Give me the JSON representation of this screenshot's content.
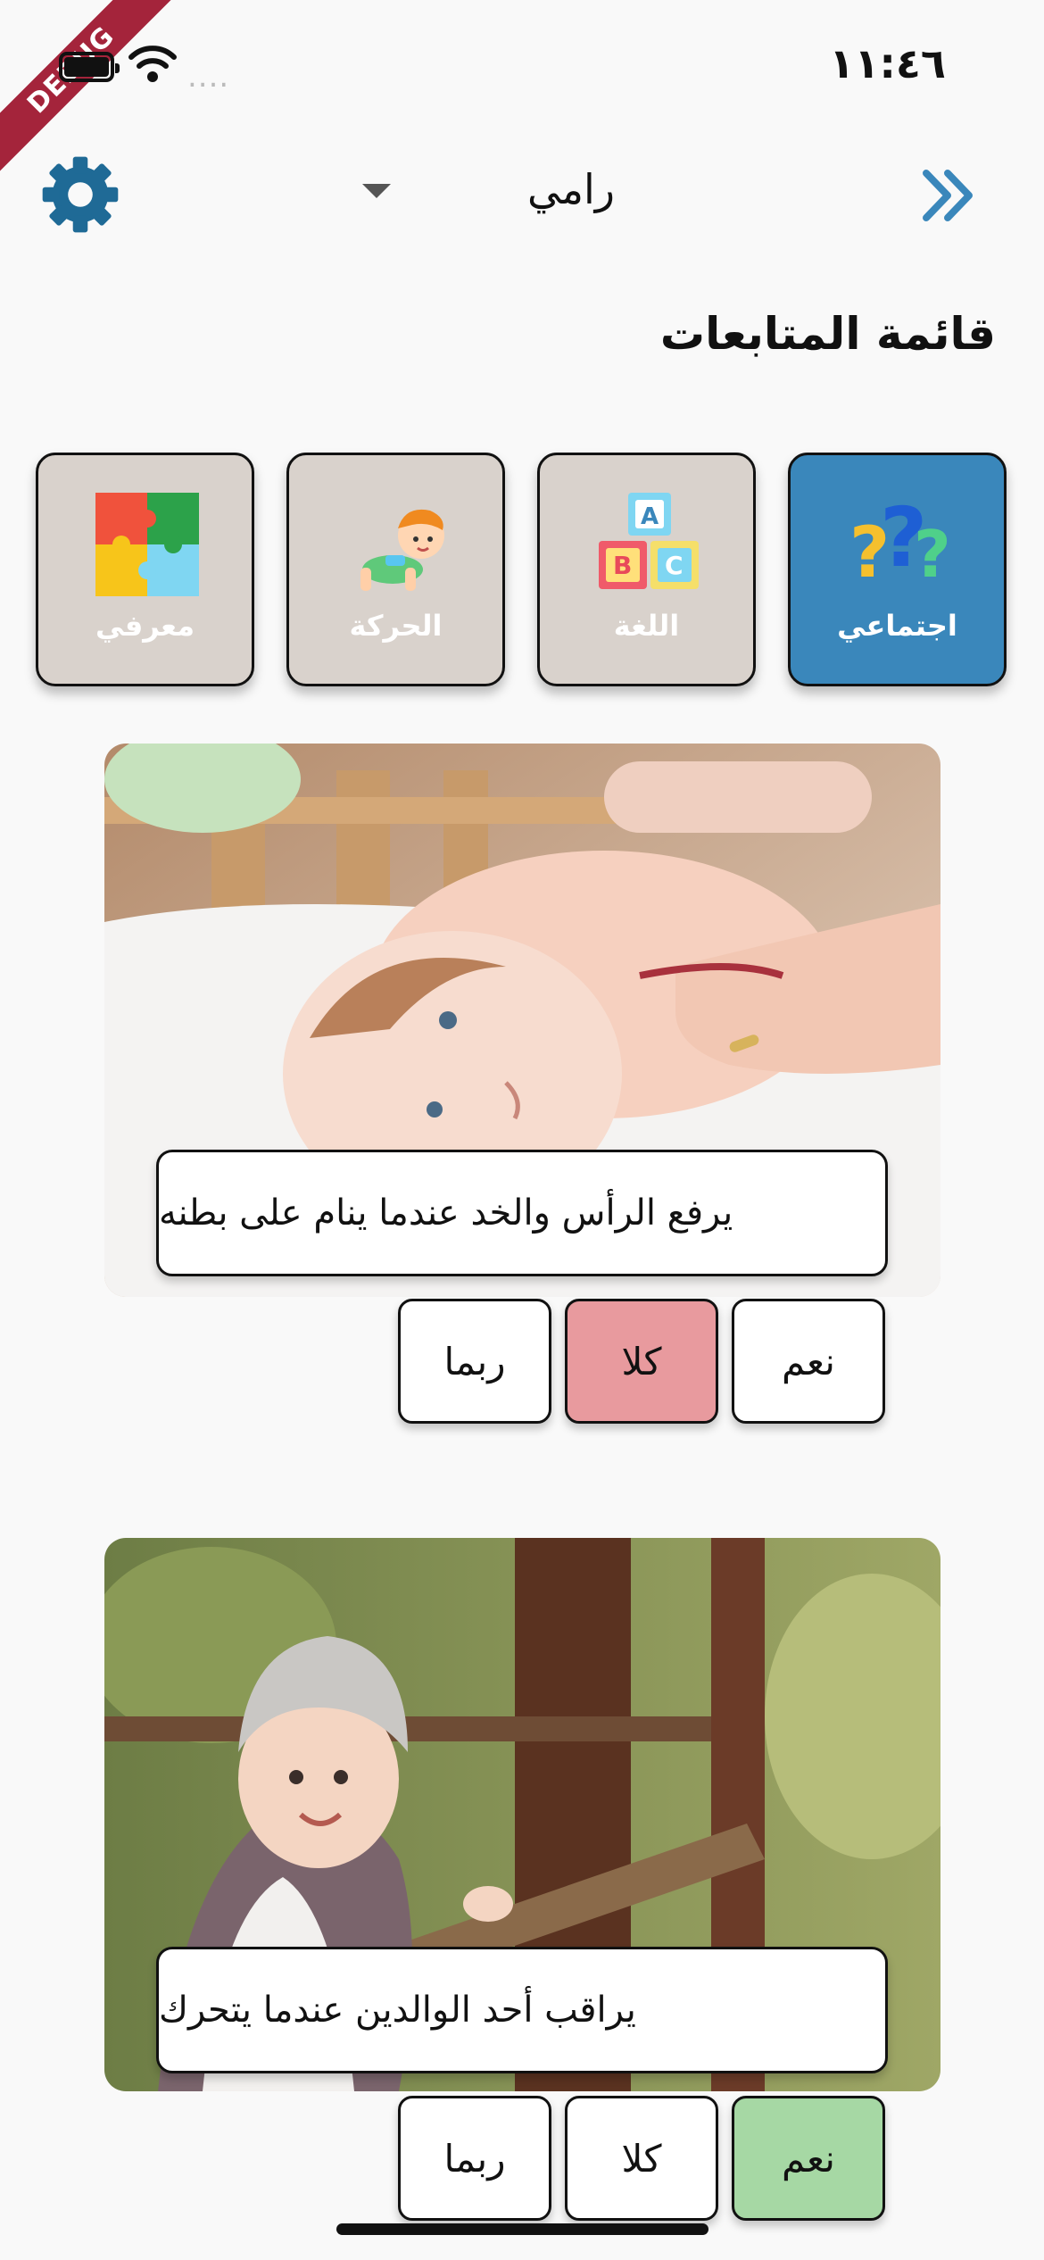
{
  "status_bar": {
    "time": "١١:٤٦",
    "debug_label": "DEBUG",
    "signal_dots": "...."
  },
  "header": {
    "child_name": "رامي",
    "title": "قائمة المتابعات"
  },
  "categories": [
    {
      "label": "اجتماعي",
      "icon": "question-marks-icon",
      "active": true
    },
    {
      "label": "اللغة",
      "icon": "abc-blocks-icon",
      "active": false
    },
    {
      "label": "الحركة",
      "icon": "crawling-baby-icon",
      "active": false
    },
    {
      "label": "معرفي",
      "icon": "puzzle-icon",
      "active": false
    }
  ],
  "questions": [
    {
      "text": "يرفع الرأس والخد عندما ينام على بطنه",
      "image": "baby-lying-on-back-photo",
      "answers": {
        "yes": "نعم",
        "no": "كلا",
        "maybe": "ربما"
      },
      "selected": "no"
    },
    {
      "text": "يراقب أحد الوالدين عندما يتحرك",
      "image": "baby-standing-at-railing-photo",
      "answers": {
        "yes": "نعم",
        "no": "كلا",
        "maybe": "ربما"
      },
      "selected": "yes"
    }
  ],
  "colors": {
    "accent": "#3a87bb",
    "card": "#d9d2cc",
    "no_selected": "#e89a9e",
    "yes_selected": "#a6d8a4"
  }
}
